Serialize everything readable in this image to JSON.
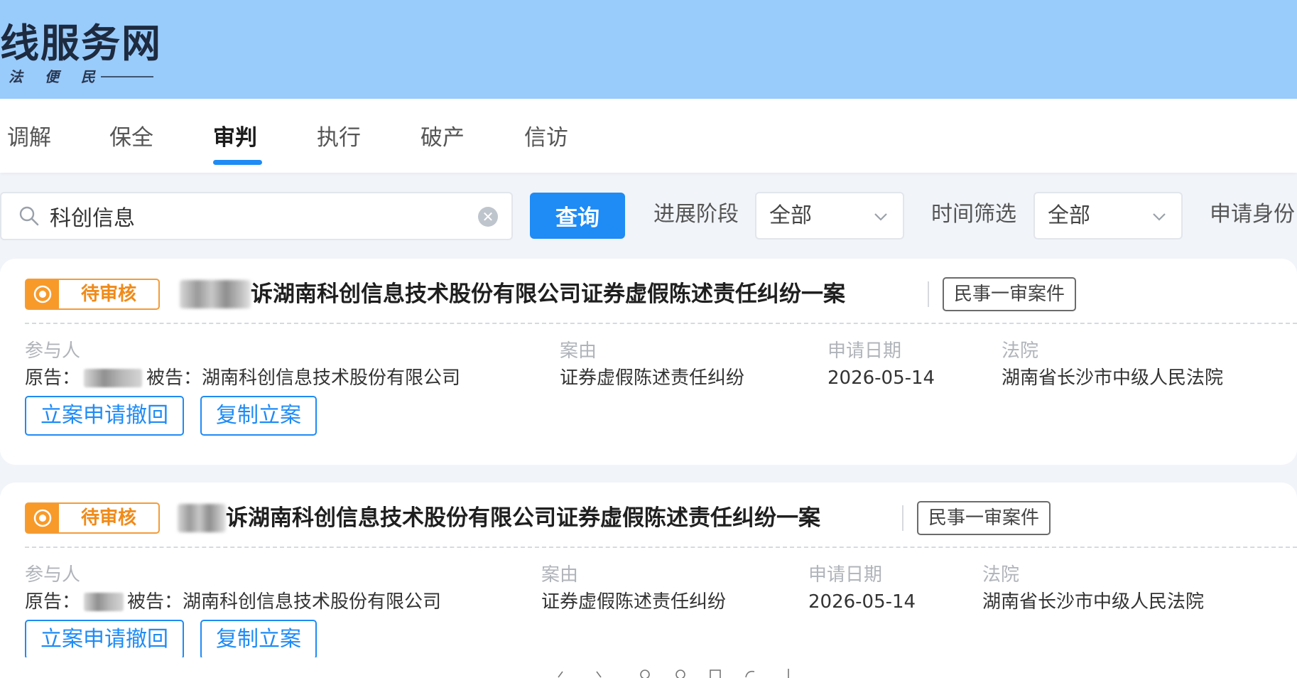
{
  "header": {
    "title": "线服务网",
    "subtitle": "法 便 民"
  },
  "tabs": [
    {
      "label": "调解",
      "active": false
    },
    {
      "label": "保全",
      "active": false
    },
    {
      "label": "审判",
      "active": true
    },
    {
      "label": "执行",
      "active": false
    },
    {
      "label": "破产",
      "active": false
    },
    {
      "label": "信访",
      "active": false
    }
  ],
  "filters": {
    "search_value": "科创信息",
    "query_label": "查询",
    "stage_label": "进展阶段",
    "stage_value": "全部",
    "time_label": "时间筛选",
    "time_value": "全部",
    "identity_label": "申请身份"
  },
  "cases": [
    {
      "status": "待审核",
      "title": "诉湖南科创信息技术股份有限公司证券虚假陈述责任纠纷一案",
      "type_tag": "民事一审案件",
      "participants_label": "参与人",
      "plaintiff_prefix": "原告：",
      "defendant_text": "被告：湖南科创信息技术股份有限公司",
      "cause_label": "案由",
      "cause_value": "证券虚假陈述责任纠纷",
      "date_label": "申请日期",
      "date_value": "2026-05-14",
      "court_label": "法院",
      "court_value": "湖南省长沙市中级人民法院",
      "withdraw_label": "立案申请撤回",
      "copy_label": "复制立案"
    },
    {
      "status": "待审核",
      "title": "诉湖南科创信息技术股份有限公司证券虚假陈述责任纠纷一案",
      "type_tag": "民事一审案件",
      "participants_label": "参与人",
      "plaintiff_prefix": "原告：",
      "defendant_text": "被告：湖南科创信息技术股份有限公司",
      "cause_label": "案由",
      "cause_value": "证券虚假陈述责任纠纷",
      "date_label": "申请日期",
      "date_value": "2026-05-14",
      "court_label": "法院",
      "court_value": "湖南省长沙市中级人民法院",
      "withdraw_label": "立案申请撤回",
      "copy_label": "复制立案"
    }
  ],
  "colors": {
    "banner": "#99cbfb",
    "accent": "#1f8bf5",
    "status_orange": "#f08a18",
    "page_bg": "#f1f4f9"
  }
}
